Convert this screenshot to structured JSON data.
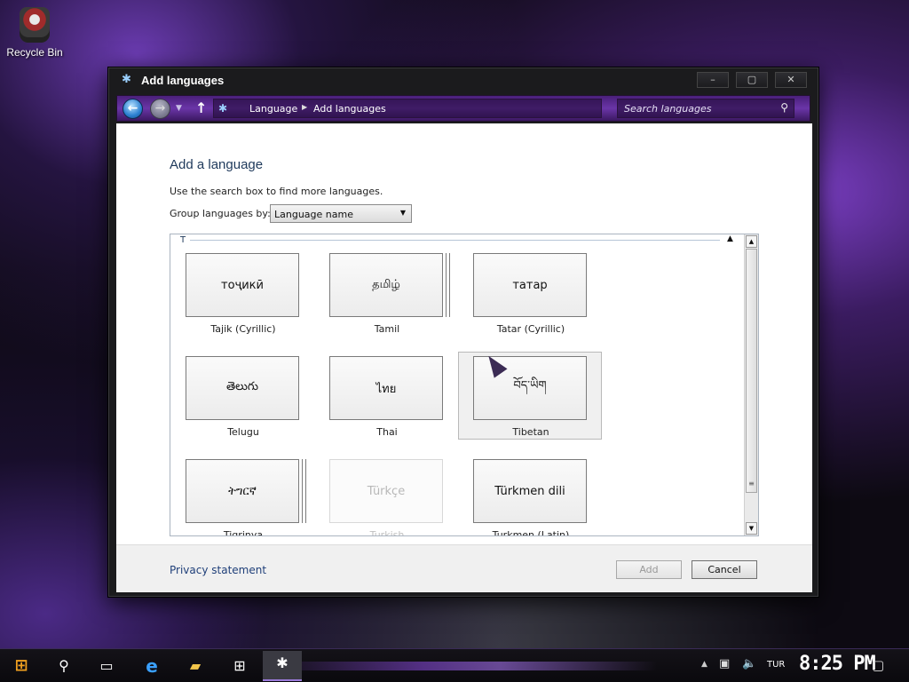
{
  "desktop": {
    "recycle_bin_label": "Recycle Bin"
  },
  "window": {
    "title": "Add languages",
    "controls": {
      "minimize": "–",
      "maximize": "▢",
      "close": "✕"
    }
  },
  "navbar": {
    "breadcrumbs": [
      "Language",
      "Add languages"
    ],
    "search_placeholder": "Search languages"
  },
  "content": {
    "heading": "Add a language",
    "help_text": "Use the search box to find more languages.",
    "group_label": "Group languages by:",
    "group_selected": "Language name",
    "group_header": "T",
    "languages": [
      {
        "native": "тоҷикӣ",
        "name": "Tajik (Cyrillic)"
      },
      {
        "native": "தமிழ்",
        "name": "Tamil"
      },
      {
        "native": "татар",
        "name": "Tatar (Cyrillic)"
      },
      {
        "native": "తెలుగు",
        "name": "Telugu"
      },
      {
        "native": "ไทย",
        "name": "Thai"
      },
      {
        "native": "བོད་ཡིག",
        "name": "Tibetan"
      },
      {
        "native": "ትግርኛ",
        "name": "Tigrinya"
      },
      {
        "native": "Türkçe",
        "name": "Turkish"
      },
      {
        "native": "Türkmen dili",
        "name": "Turkmen (Latin)"
      }
    ]
  },
  "footer": {
    "privacy_link": "Privacy statement",
    "add_button": "Add",
    "cancel_button": "Cancel"
  },
  "taskbar": {
    "language": "TUR",
    "clock": "8:25 PM"
  }
}
